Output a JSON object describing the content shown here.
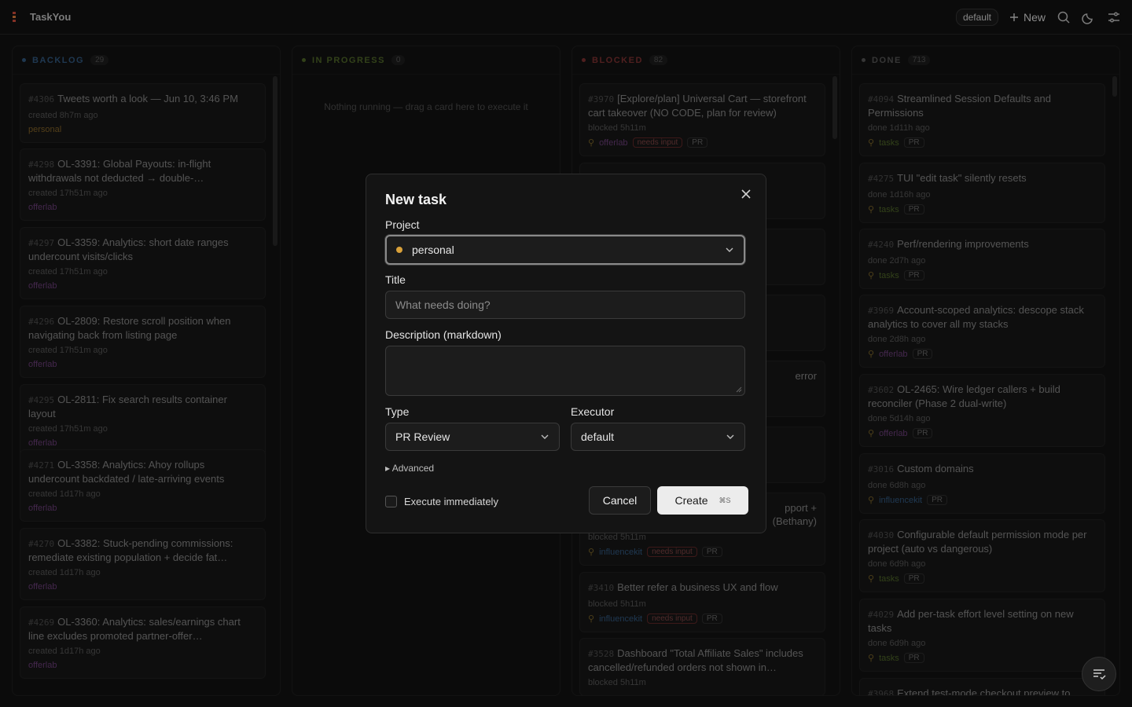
{
  "app": {
    "title": "TaskYou"
  },
  "header": {
    "executor_pill": "default",
    "new_label": "New"
  },
  "columns": [
    {
      "name": "BACKLOG",
      "count": "29",
      "color": "#4a8fd6"
    },
    {
      "name": "IN PROGRESS",
      "count": "0",
      "color": "#7faa3a",
      "empty": "Nothing running — drag a card here to execute it"
    },
    {
      "name": "BLOCKED",
      "count": "82",
      "color": "#d24a4a"
    },
    {
      "name": "DONE",
      "count": "713",
      "color": "#8a8a8a"
    }
  ],
  "backlog": [
    {
      "id": "#4306",
      "title": "Tweets worth a look — Jun 10, 3:46 PM",
      "meta": "created 8h7m ago",
      "project": "personal",
      "project_color": "#d9a13a"
    },
    {
      "id": "#4298",
      "title": "OL-3391: Global Payouts: in-flight withdrawals not deducted → double-…",
      "meta": "created 17h51m ago",
      "project": "offerlab",
      "project_color": "#b061c9"
    },
    {
      "id": "#4297",
      "title": "OL-3359: Analytics: short date ranges undercount visits/clicks",
      "meta": "created 17h51m ago",
      "project": "offerlab",
      "project_color": "#b061c9"
    },
    {
      "id": "#4296",
      "title": "OL-2809: Restore scroll position when navigating back from listing page",
      "meta": "created 17h51m ago",
      "project": "offerlab",
      "project_color": "#b061c9"
    },
    {
      "id": "#4295",
      "title": "OL-2811: Fix search results container layout",
      "meta": "created 17h51m ago",
      "project": "offerlab",
      "project_color": "#b061c9"
    },
    {
      "id": "#4271",
      "title": "OL-3358: Analytics: Ahoy rollups undercount backdated / late-arriving events",
      "meta": "created 1d17h ago",
      "project": "offerlab",
      "project_color": "#b061c9"
    },
    {
      "id": "#4270",
      "title": "OL-3382: Stuck-pending commissions: remediate existing population + decide fat…",
      "meta": "created 1d17h ago",
      "project": "offerlab",
      "project_color": "#b061c9"
    },
    {
      "id": "#4269",
      "title": "OL-3360: Analytics: sales/earnings chart line excludes promoted partner-offer…",
      "meta": "created 1d17h ago",
      "project": "offerlab",
      "project_color": "#b061c9"
    }
  ],
  "blocked": [
    {
      "id": "#3970",
      "title": "[Explore/plan] Universal Cart — storefront cart takeover (NO CODE, plan for review)",
      "meta": "blocked 5h11m",
      "project": "offerlab",
      "project_color": "#b061c9",
      "needs": "needs input",
      "pr": "PR"
    },
    {
      "id": "#3410",
      "title": "Better refer a business UX and flow",
      "meta": "blocked 5h11m",
      "project": "influencekit",
      "project_color": "#4a8fd6",
      "needs": "needs input",
      "pr": "PR"
    },
    {
      "id": "#3528",
      "title": "Dashboard \"Total Affiliate Sales\" includes cancelled/refunded orders not shown in…",
      "meta": "blocked 5h11m"
    }
  ],
  "blocked_partial": {
    "frag1": "error",
    "frag2": "pport +",
    "frag3": "(Bethany)",
    "frag_meta": "blocked 5h11m",
    "frag_project": "influencekit",
    "frag_needs": "needs input",
    "frag_pr": "PR"
  },
  "done": [
    {
      "id": "#4094",
      "title": "Streamlined Session Defaults and Permissions",
      "meta": "done 1d11h ago",
      "project": "tasks",
      "project_color": "#7faa3a",
      "pr": "PR"
    },
    {
      "id": "#4275",
      "title": "TUI \"edit task\" silently resets",
      "meta": "done 1d16h ago",
      "project": "tasks",
      "project_color": "#7faa3a",
      "pr": "PR"
    },
    {
      "id": "#4240",
      "title": "Perf/rendering improvements",
      "meta": "done 2d7h ago",
      "project": "tasks",
      "project_color": "#7faa3a",
      "pr": "PR"
    },
    {
      "id": "#3969",
      "title": "Account-scoped analytics: descope stack analytics to cover all my stacks",
      "meta": "done 2d8h ago",
      "project": "offerlab",
      "project_color": "#b061c9",
      "pr": "PR"
    },
    {
      "id": "#3602",
      "title": "OL-2465: Wire ledger callers + build reconciler (Phase 2 dual-write)",
      "meta": "done 5d14h ago",
      "project": "offerlab",
      "project_color": "#b061c9",
      "pr": "PR"
    },
    {
      "id": "#3016",
      "title": "Custom domains",
      "meta": "done 6d8h ago",
      "project": "influencekit",
      "project_color": "#4a8fd6",
      "pr": "PR"
    },
    {
      "id": "#4030",
      "title": "Configurable default permission mode per project (auto vs dangerous)",
      "meta": "done 6d9h ago",
      "project": "tasks",
      "project_color": "#7faa3a",
      "pr": "PR"
    },
    {
      "id": "#4029",
      "title": "Add per-task effort level setting on new tasks",
      "meta": "done 6d9h ago",
      "project": "tasks",
      "project_color": "#7faa3a",
      "pr": "PR"
    },
    {
      "id": "#3968",
      "title": "Extend test-mode checkout preview to"
    }
  ],
  "modal": {
    "title": "New task",
    "project_label": "Project",
    "project_value": "personal",
    "project_color": "#d9a13a",
    "title_label": "Title",
    "title_placeholder": "What needs doing?",
    "description_label": "Description (markdown)",
    "type_label": "Type",
    "type_value": "PR Review",
    "executor_label": "Executor",
    "executor_value": "default",
    "advanced": "▸ Advanced",
    "execute_label": "Execute immediately",
    "cancel_label": "Cancel",
    "create_label": "Create",
    "create_shortcut": "⌘S"
  }
}
